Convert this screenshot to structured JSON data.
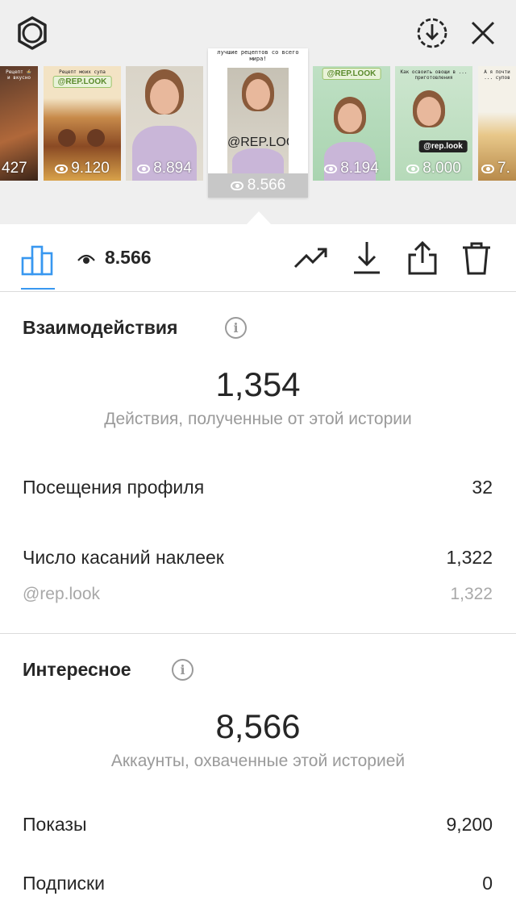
{
  "header": {
    "settings_icon": "gear-icon",
    "download_all_icon": "download-circle-icon",
    "close_icon": "close-icon"
  },
  "stories": [
    {
      "views": "427",
      "caption": "Рецепт 🍲 и вкусно"
    },
    {
      "views": "9.120",
      "caption": "Рецепт моих супа",
      "tag": "@REP.LOOK"
    },
    {
      "views": "8.894",
      "caption": ""
    },
    {
      "views": "8.194",
      "caption": "",
      "tag": "@REP.LOOK"
    },
    {
      "views": "8.000",
      "caption": "Как освоить овощи в ... приготовления",
      "tag": "@rep.look"
    },
    {
      "views": "7.",
      "caption": "А я почти ... супов"
    }
  ],
  "selected_story": {
    "views": "8.566",
    "caption": "лучшие рецептов со всего мира!",
    "tag": "@REP.LOOK"
  },
  "toolbar": {
    "view_count": "8.566",
    "icons": [
      "bar-chart-icon",
      "eye-icon",
      "trending-icon",
      "download-icon",
      "share-icon",
      "trash-icon"
    ]
  },
  "interactions": {
    "title": "Взаимодействия",
    "total": "1,354",
    "total_desc": "Действия, полученные от этой истории",
    "rows": [
      {
        "label": "Посещения профиля",
        "value": "32"
      },
      {
        "label": "Число касаний наклеек",
        "value": "1,322"
      }
    ],
    "sub_rows": [
      {
        "label": "@rep.look",
        "value": "1,322"
      }
    ]
  },
  "discovery": {
    "title": "Интересное",
    "total": "8,566",
    "total_desc": "Аккаунты, охваченные этой историей",
    "rows": [
      {
        "label": "Показы",
        "value": "9,200"
      },
      {
        "label": "Подписки",
        "value": "0"
      }
    ]
  },
  "colors": {
    "accent": "#3897f0",
    "text": "#262626",
    "muted": "#9a9a9a",
    "top_bg": "#efefef"
  }
}
